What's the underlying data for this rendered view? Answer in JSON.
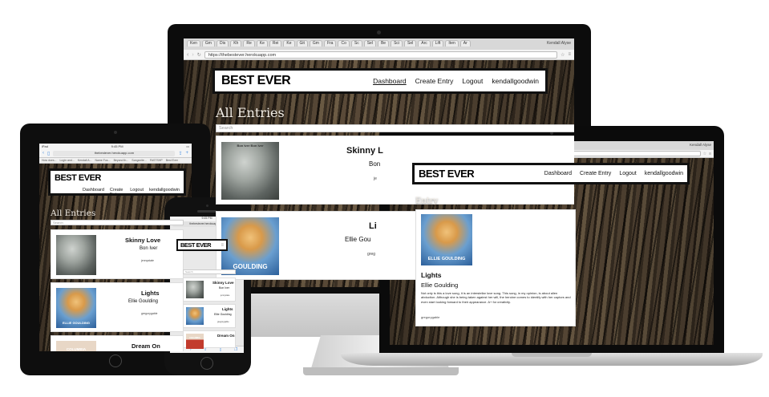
{
  "site": {
    "logo": "BEST EVER",
    "nav": {
      "dashboard": "Dashboard",
      "create_entry": "Create Entry",
      "logout": "Logout",
      "user": "kendallgoodwin"
    },
    "search_placeholder": "Search"
  },
  "imac": {
    "tabs": [
      "Ken",
      "Gm",
      "Dis",
      "Kh",
      "Re",
      "Ke",
      "Rei",
      "Ke",
      "Git",
      "Gm",
      "Fra",
      "Co",
      "Sc",
      "Sel",
      "Be",
      "Sci",
      "Sel",
      "Arc",
      "Lift",
      "Iten",
      "Ar"
    ],
    "profile": "Kendall Alyse",
    "url": "https://thebestever.herokuapp.com",
    "heading": "All Entries",
    "entries": [
      {
        "title": "Skinny L",
        "artist": "Bon",
        "user": "je",
        "cover_caption": "Bon Iver  Bon Iver"
      },
      {
        "title": "Li",
        "artist": "Ellie Gou",
        "user": "greg",
        "cover_caption": "GOULDING"
      }
    ]
  },
  "ipad": {
    "status_left": "iPad",
    "status_time": "9:45 PM",
    "url": "thebestever.herokuapp.com",
    "bookmarks": [
      "How does...",
      "Login and...",
      "Kendall A...",
      "Name Fus...",
      "Beyond th...",
      "Songwrite...",
      "FASTSHP",
      "Best Ever"
    ],
    "heading": "All Entries",
    "search_placeholder": "Search",
    "entries": [
      {
        "title": "Skinny Love",
        "artist": "Bon Iver",
        "user": "jennystate"
      },
      {
        "title": "Lights",
        "artist": "Ellie Goulding",
        "user": "gregorygable",
        "cover_caption": "ELLIE GOULDING"
      },
      {
        "title": "Dream On",
        "artist": "",
        "user": "",
        "cover_caption": "COLUMBIA"
      }
    ]
  },
  "phone": {
    "status_time": "9:45 PM",
    "url": "thebestever.herokuapp.com",
    "entries": [
      {
        "title": "Skinny Love",
        "artist": "Bon Iver",
        "user": "jennystate"
      },
      {
        "title": "Lights",
        "artist": "Ellie Goulding",
        "user": "gregorygable"
      },
      {
        "title": "Dream On",
        "artist": "",
        "user": "",
        "cover_caption": "COLUMBIA"
      }
    ]
  },
  "laptop": {
    "tabs": [
      "Dis",
      "Ke",
      "Wa",
      "Ga",
      "Gu",
      "Ap",
      "Fi",
      "Au",
      "Ke",
      "Aa",
      "Ni",
      "Le"
    ],
    "profile": "Kendall Alyse",
    "url": "https://thebestever.herokuapp.com/entry/573a3707b6d8e900000070417",
    "heading": "Entry",
    "entry": {
      "title": "Lights",
      "artist": "Ellie Goulding",
      "cover_caption": "ELLIE GOULDING",
      "body": "Not only is this a love song, it is an interstellar love song. This song, in my opinion, is about alien abduction. Although she is being taken against her will, the heroine comes to identify with her captors and even start looking forward to their appearance. A+ for creativity.",
      "user": "gregorygable"
    }
  },
  "colors": {
    "bezel": "#0c0c0c",
    "aluminum": "#c4c4c4",
    "card": "#ffffff",
    "heading": "#f3eee6"
  }
}
